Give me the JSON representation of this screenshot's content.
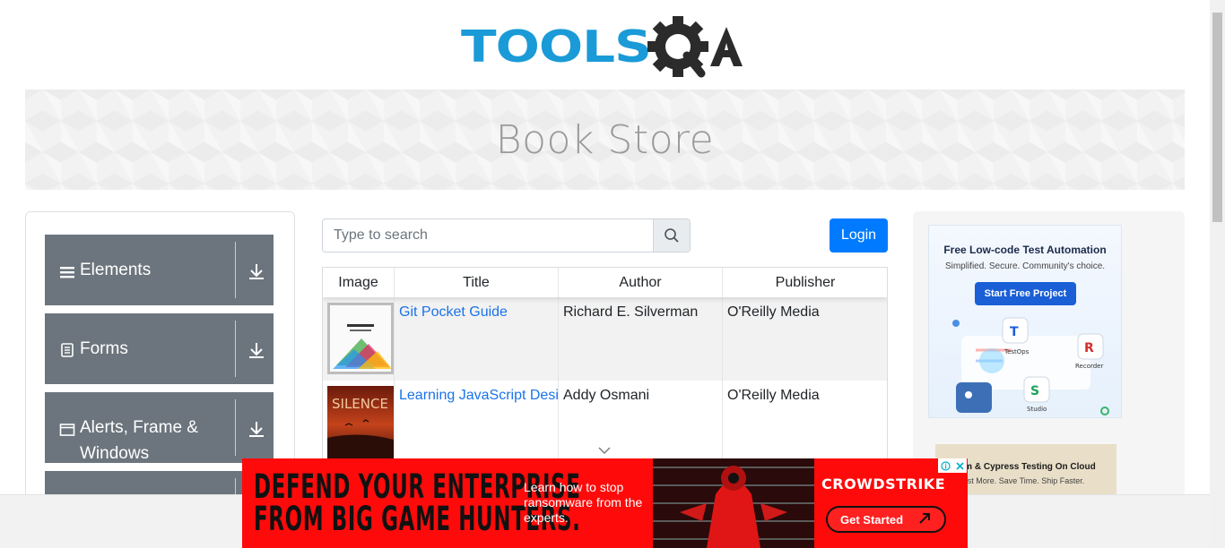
{
  "logo": {
    "text_tools": "TOOLS",
    "text_qa": "A"
  },
  "banner": {
    "title": "Book Store"
  },
  "sidebar": {
    "groups": [
      {
        "label": "Elements",
        "icon": "hamburger-icon"
      },
      {
        "label": "Forms",
        "icon": "form-icon"
      },
      {
        "label": "Alerts, Frame & Windows",
        "icon": "window-icon"
      }
    ]
  },
  "search": {
    "placeholder": "Type to search"
  },
  "login": {
    "label": "Login"
  },
  "table": {
    "headers": [
      "Image",
      "Title",
      "Author",
      "Publisher"
    ],
    "rows": [
      {
        "title": "Git Pocket Guide",
        "author": "Richard E. Silverman",
        "publisher": "O'Reilly Media"
      },
      {
        "title": "Learning JavaScript Design Patterns",
        "author": "Addy Osmani",
        "publisher": "O'Reilly Media"
      }
    ]
  },
  "ad_right": {
    "card1": {
      "title": "Free Low-code Test Automation",
      "subtitle": "Simplified. Secure. Community's choice.",
      "cta": "Start Free Project",
      "labels": [
        "TestOps",
        "Recorder",
        "Studio"
      ]
    },
    "card2": {
      "title": "ium & Cypress Testing On Cloud",
      "subtitle": "st More. Save Time. Ship Faster."
    }
  },
  "bottom_ad": {
    "headline_line1": "DEFEND YOUR ENTERPRISE",
    "headline_line2": "FROM BIG GAME HUNTERS.",
    "subtext": "Learn how to stop ransomware from the experts.",
    "brand": "CROWDSTRIKE",
    "cta": "Get Started",
    "colors": {
      "background": "#ff0a0a",
      "text_dark": "#111111"
    }
  },
  "colors": {
    "accent": "#007bff",
    "sidebar_group": "#6c757d",
    "logo_blue": "#1a9bd7",
    "link": "#1a73e8"
  }
}
